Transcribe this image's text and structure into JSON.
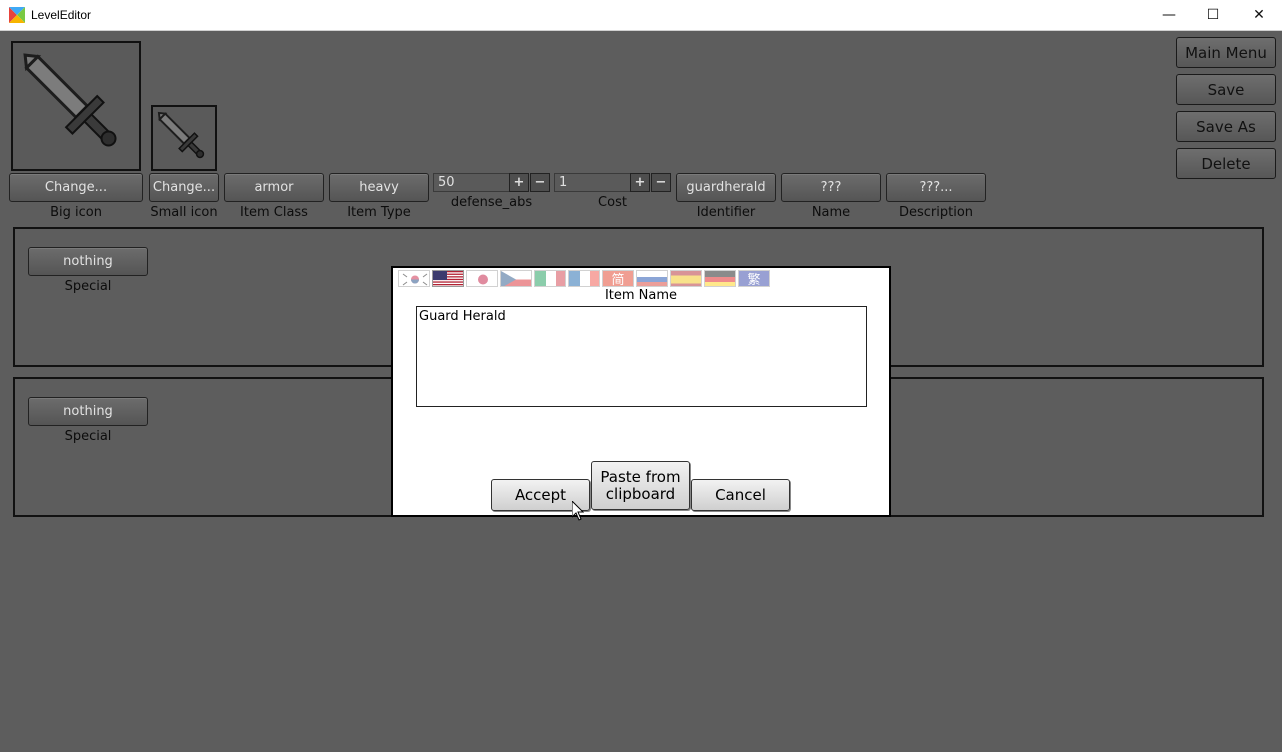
{
  "window": {
    "title": "LevelEditor",
    "minimize_glyph": "—",
    "maximize_glyph": "☐",
    "close_glyph": "✕"
  },
  "toolbar": {
    "big_icon_button": "Change...",
    "big_icon_label": "Big icon",
    "small_icon_button": "Change...",
    "small_icon_label": "Small icon",
    "item_class_value": "armor",
    "item_class_label": "Item Class",
    "item_type_value": "heavy",
    "item_type_label": "Item Type",
    "defense_abs_value": "50",
    "defense_abs_label": "defense_abs",
    "cost_value": "1",
    "cost_label": "Cost",
    "plus": "+",
    "minus": "−",
    "identifier_value": "guardherald",
    "identifier_label": "Identifier",
    "name_value": "???",
    "name_label": "Name",
    "description_value": "???...",
    "description_label": "Description"
  },
  "right_menu": {
    "main_menu": "Main Menu",
    "save": "Save",
    "save_as": "Save As",
    "delete": "Delete"
  },
  "panels": [
    {
      "special_button": "nothing",
      "special_label": "Special"
    },
    {
      "special_button": "nothing",
      "special_label": "Special"
    }
  ],
  "dialog": {
    "languages": [
      "korean",
      "english",
      "japanese",
      "czech",
      "italian",
      "french",
      "chinese-simplified",
      "russian",
      "spanish",
      "german",
      "chinese-traditional"
    ],
    "chinese_simplified_glyph": "简",
    "chinese_traditional_glyph": "繁",
    "title": "Item Name",
    "text": "Guard Herald",
    "accept": "Accept",
    "paste_line1": "Paste from",
    "paste_line2": "clipboard",
    "cancel": "Cancel"
  }
}
